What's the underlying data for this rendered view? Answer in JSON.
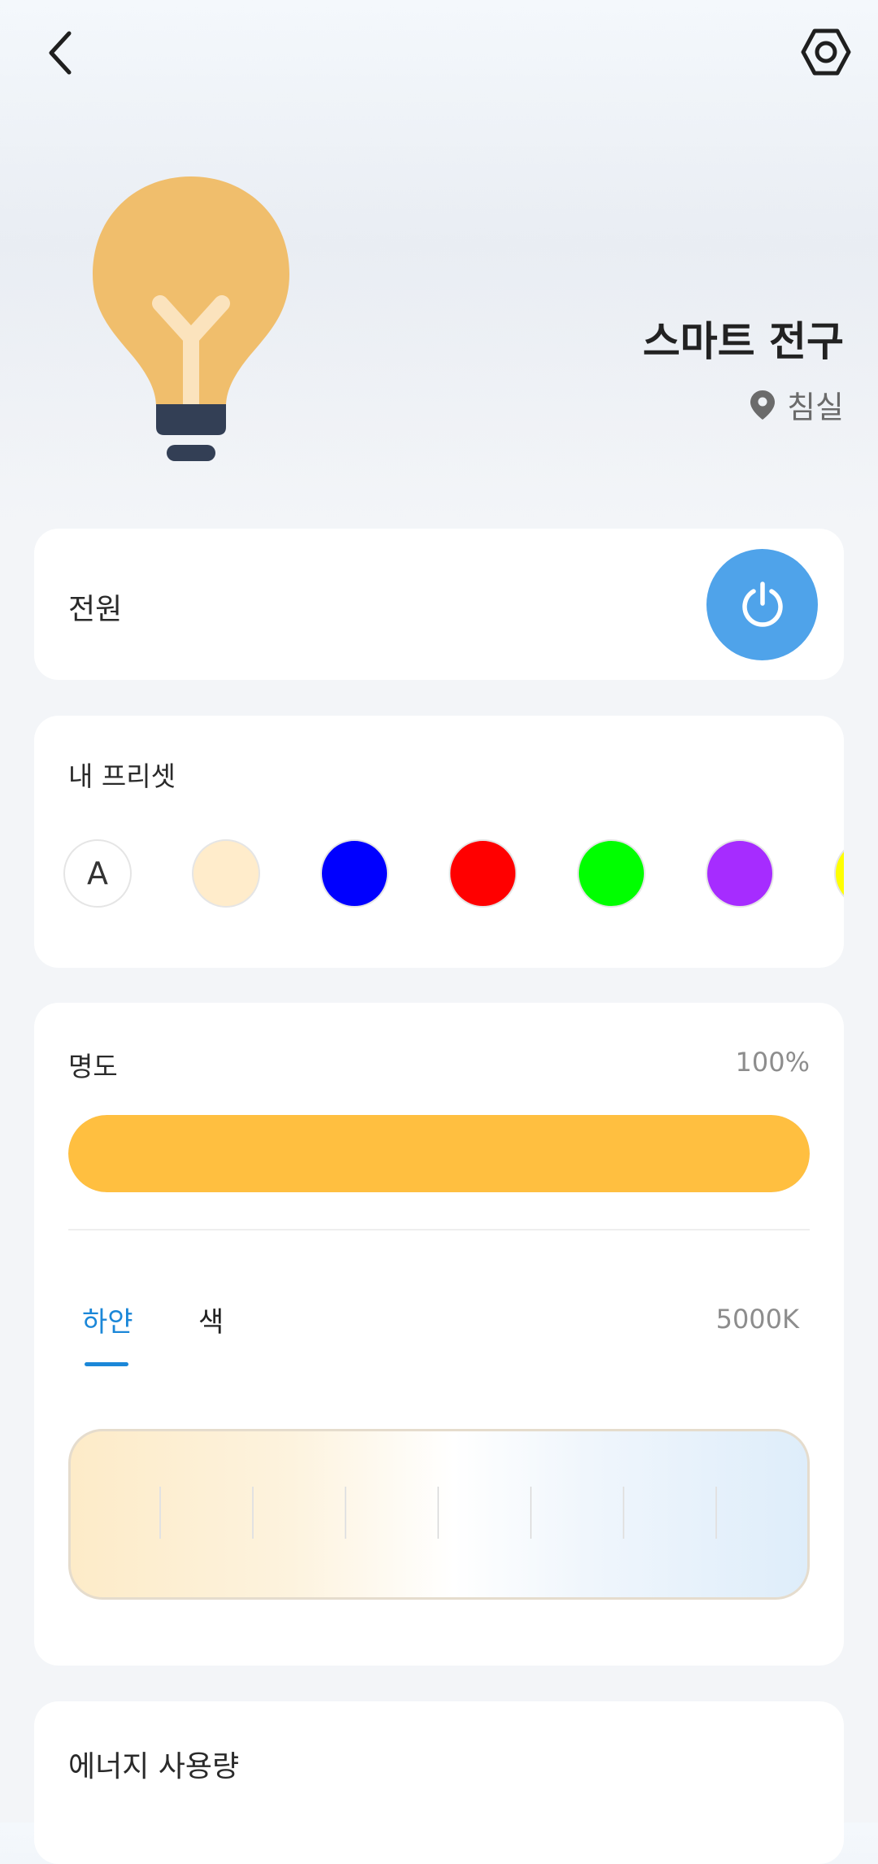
{
  "device": {
    "name": "스마트 전구",
    "room": "침실"
  },
  "power": {
    "label": "전원",
    "on": true
  },
  "presets": {
    "title": "내 프리셋",
    "auto_label": "A",
    "colors": [
      "#ffeccb",
      "#0000ff",
      "#ff0000",
      "#00ff00",
      "#a62cff",
      "#ffff00"
    ]
  },
  "brightness": {
    "label": "명도",
    "value_text": "100%",
    "value": 100,
    "color": "#ffbf40"
  },
  "mode_tabs": {
    "white": "하얀",
    "color": "색",
    "active": "white"
  },
  "color_temp": {
    "value_text": "5000K"
  },
  "energy": {
    "title": "에너지 사용량"
  },
  "colors": {
    "accent": "#1b87d8",
    "power_button": "#4fa3ea",
    "bulb": "#f0be6c",
    "bulb_base": "#333f55"
  }
}
